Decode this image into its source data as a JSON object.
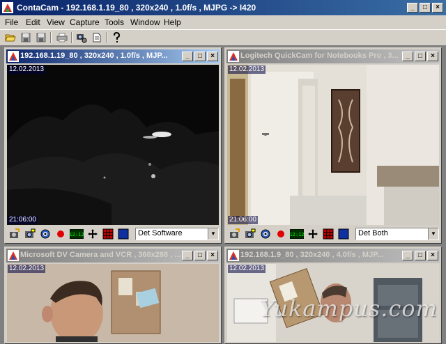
{
  "app": {
    "title": "ContaCam - 192.168.1.19_80 , 320x240 , 1.0f/s , MJPG -> I420",
    "window_buttons": [
      "_",
      "□",
      "×"
    ]
  },
  "menu": {
    "items": [
      "File",
      "Edit",
      "View",
      "Capture",
      "Tools",
      "Window",
      "Help"
    ]
  },
  "toolbar": {
    "icons": [
      "open-icon",
      "save-icon",
      "save-all-icon",
      "print-icon",
      "camera-settings-icon",
      "document-icon",
      "help-icon"
    ]
  },
  "cameras": [
    {
      "title": "192.168.1.19_80 , 320x240 , 1.0f/s , MJP...",
      "date": "12.02.2013",
      "time": "21:06:00",
      "detection": "Det Software",
      "state": "active"
    },
    {
      "title": "Logitech QuickCam for Notebooks Pro , 3...",
      "date": "12.02.2013",
      "time": "21:06:00",
      "detection": "Det Both",
      "state": "inactive"
    },
    {
      "title": "Microsoft DV Camera and VCR , 360x288 , ...",
      "date": "12.02.2013",
      "state": "inactive"
    },
    {
      "title": "192.168.1.9_80 , 320x240 , 4.0f/s , MJP...",
      "date": "12.02.2013",
      "state": "inactive"
    }
  ],
  "camera_toolbar": {
    "clock_label": "12:12",
    "icons": [
      "snapshot-settings-icon",
      "camera-capture-icon",
      "webcam-icon",
      "record-icon",
      "clock-icon",
      "move-icon",
      "grid-icon",
      "fullscreen-icon"
    ]
  },
  "watermark": "Yukampus.com",
  "colors": {
    "active_title": "#0a246a",
    "inactive_title": "#808080",
    "record": "#e00000",
    "clock_green": "#00c000"
  }
}
